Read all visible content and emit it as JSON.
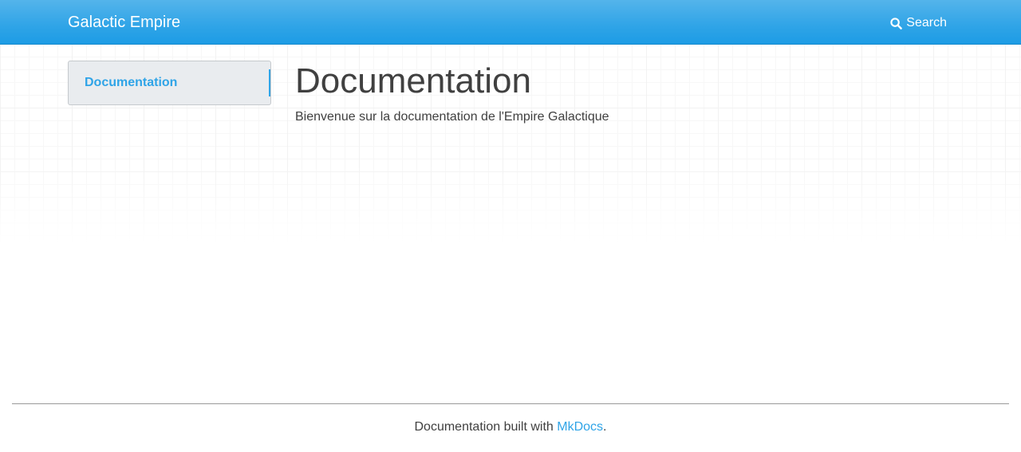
{
  "header": {
    "brand": "Galactic Empire",
    "search_label": "Search",
    "search_icon": "search-icon",
    "background_color": "#2fa4e7"
  },
  "sidebar": {
    "items": [
      {
        "label": "Documentation",
        "active": true
      }
    ]
  },
  "main": {
    "title": "Documentation",
    "intro": "Bienvenue sur la documentation de l'Empire Galactique"
  },
  "footer": {
    "prefix": "Documentation built with ",
    "link_text": "MkDocs",
    "suffix": "."
  },
  "colors": {
    "accent": "#2fa4e7",
    "text": "#404040",
    "sidebar_bg": "#e9ecef"
  }
}
